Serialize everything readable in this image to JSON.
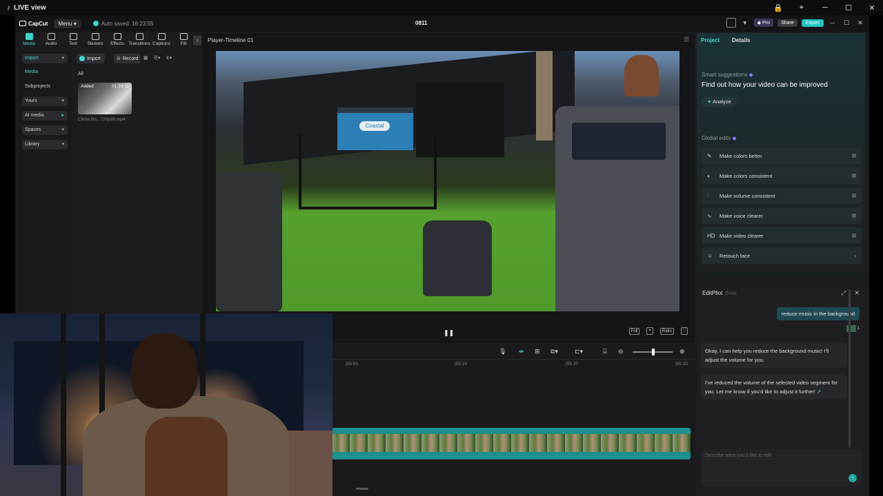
{
  "os": {
    "title": "LIVE view",
    "controls": [
      "🔒",
      "⌖",
      "─",
      "☐",
      "✕"
    ]
  },
  "titlebar": {
    "logo": "CapCut",
    "menu": "Menu",
    "autosave": "Auto saved: 16:23:55",
    "project_title": "0811",
    "pro": "Pro",
    "share": "Share",
    "export": "Export",
    "win_controls": [
      "─",
      "☐",
      "✕"
    ]
  },
  "tools": [
    {
      "label": "Media",
      "active": true
    },
    {
      "label": "Audio"
    },
    {
      "label": "Text"
    },
    {
      "label": "Stickers"
    },
    {
      "label": "Effects"
    },
    {
      "label": "Transitions"
    },
    {
      "label": "Captions"
    },
    {
      "label": "Filt"
    }
  ],
  "leftnav": {
    "import": "Import",
    "media": "Media",
    "subprojects": "Subprojects",
    "yours": "Yours",
    "ai_media": "AI media",
    "spaces": "Spaces",
    "library": "Library"
  },
  "media_panel": {
    "import_btn": "Import",
    "record_btn": "Record",
    "all": "All",
    "thumb_added": "Added",
    "thumb_duration": "01:23:11",
    "thumb_name": "ChrisLifts...720p30.mp4"
  },
  "player": {
    "title": "Player-Timeline 01",
    "controls": [
      "Full",
      "⌖",
      "Ratio",
      "⛶"
    ],
    "bin_text": "Coastal"
  },
  "timeline": {
    "ruler": [
      "|55:00",
      "|55:10",
      "|55:20",
      "|55:30"
    ]
  },
  "right_panel": {
    "tabs": [
      "Project",
      "Details"
    ],
    "smart_label": "Smart suggestions",
    "smart_title": "Find out how your video can be improved",
    "analyze": "Analyze",
    "global_label": "Global edits",
    "edits": [
      {
        "icon": "✎",
        "label": "Make colors better"
      },
      {
        "icon": "◐",
        "label": "Make colors consistent"
      },
      {
        "icon": "⫶",
        "label": "Make volume consistent"
      },
      {
        "icon": "∿",
        "label": "Make voice clearer"
      },
      {
        "icon": "HD",
        "label": "Make video clearer"
      },
      {
        "icon": "☺",
        "label": "Retouch face"
      }
    ]
  },
  "editpilot": {
    "title": "EditPilot",
    "beta": "Beta",
    "user_msg": "reduce music in the background",
    "attach_count": "1",
    "bot1": "Okay, I can help you reduce the background music! I'll adjust the volume for you.",
    "bot2": "I've reduced the volume of the selected video segment for you. Let me know if you'd like to adjust it further!",
    "placeholder": "Describe what you'd like to edit"
  }
}
